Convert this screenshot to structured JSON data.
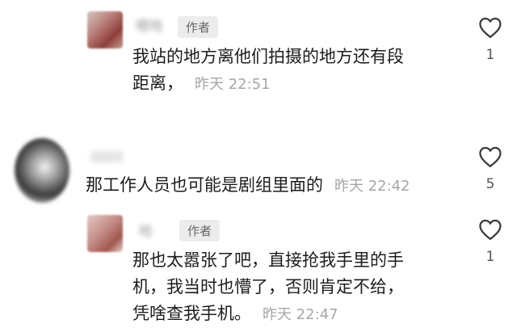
{
  "comments": [
    {
      "name": "嗯哈",
      "badge": "作者",
      "lines": [
        "我站的地方离他们拍摄的地方还有段",
        "距离，"
      ],
      "time": "昨天 22:51",
      "likes": "1"
    },
    {
      "name": "",
      "badge": "",
      "lines": [
        "那工作人员也可能是剧组里面的"
      ],
      "time": "昨天 22:42",
      "likes": "5"
    },
    {
      "name": "哈",
      "badge": "作者",
      "lines": [
        "那也太嚣张了吧，直接抢我手里的手",
        "机，我当时也懵了，否则肯定不给，",
        "凭啥查我手机。"
      ],
      "time": "昨天 22:47",
      "likes": "1"
    }
  ],
  "icons": {
    "like": "heart-outline-icon"
  }
}
